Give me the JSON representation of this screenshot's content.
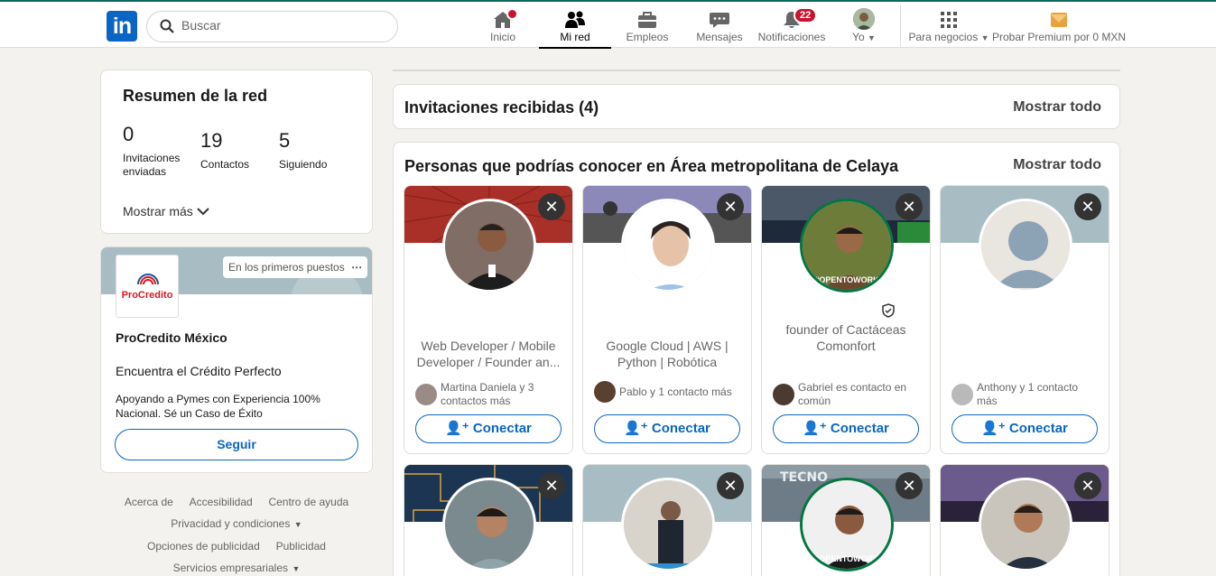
{
  "nav": {
    "search_placeholder": "Buscar",
    "items": [
      {
        "label": "Inicio"
      },
      {
        "label": "Mi red"
      },
      {
        "label": "Empleos"
      },
      {
        "label": "Mensajes"
      },
      {
        "label": "Notificaciones",
        "badge": "22"
      },
      {
        "label": "Yo"
      }
    ],
    "business_label": "Para negocios",
    "premium_label": "Probar Premium por 0 MXN"
  },
  "summary": {
    "title": "Resumen de la red",
    "stats": [
      {
        "value": "0",
        "label": "Invitaciones enviadas"
      },
      {
        "value": "19",
        "label": "Contactos"
      },
      {
        "value": "5",
        "label": "Siguiendo"
      }
    ],
    "more": "Mostrar más"
  },
  "ad": {
    "tag": "En los primeros puestos",
    "logo_text": "ProCredito",
    "company": "ProCredito México",
    "headline": "Encuentra el Crédito Perfecto",
    "body": "Apoyando a Pymes con Experiencia 100% Nacional. Sé un Caso de Éxito",
    "button": "Seguir"
  },
  "footer": {
    "links": [
      "Acerca de",
      "Accesibilidad",
      "Centro de ayuda",
      "Privacidad y condiciones",
      "Opciones de publicidad",
      "Publicidad",
      "Servicios empresariales"
    ]
  },
  "invitations": {
    "title": "Invitaciones recibidas (4)",
    "show_all": "Mostrar todo"
  },
  "suggestions": {
    "title": "Personas que podrías conocer en Área metropolitana de Celaya",
    "show_all": "Mostrar todo",
    "connect_label": "Conectar",
    "people": [
      {
        "name": "",
        "headline": "Web Developer / Mobile Developer  / Founder an...",
        "mutual": "Martina Daniela y 3 contactos más"
      },
      {
        "name": "",
        "headline": "Google Cloud | AWS | Python | Robótica",
        "mutual": "Pablo y 1 contacto más"
      },
      {
        "name": "",
        "headline": "founder of Cactáceas Comonfort",
        "mutual": "Gabriel es contacto en común"
      },
      {
        "name": "",
        "headline": "",
        "mutual": "Anthony y 1 contacto más"
      }
    ],
    "opentowork": "#OPENTOWORK"
  },
  "colors": {
    "brand": "#0a66c2",
    "badge": "#cb112d",
    "opentowork": "#057642"
  }
}
